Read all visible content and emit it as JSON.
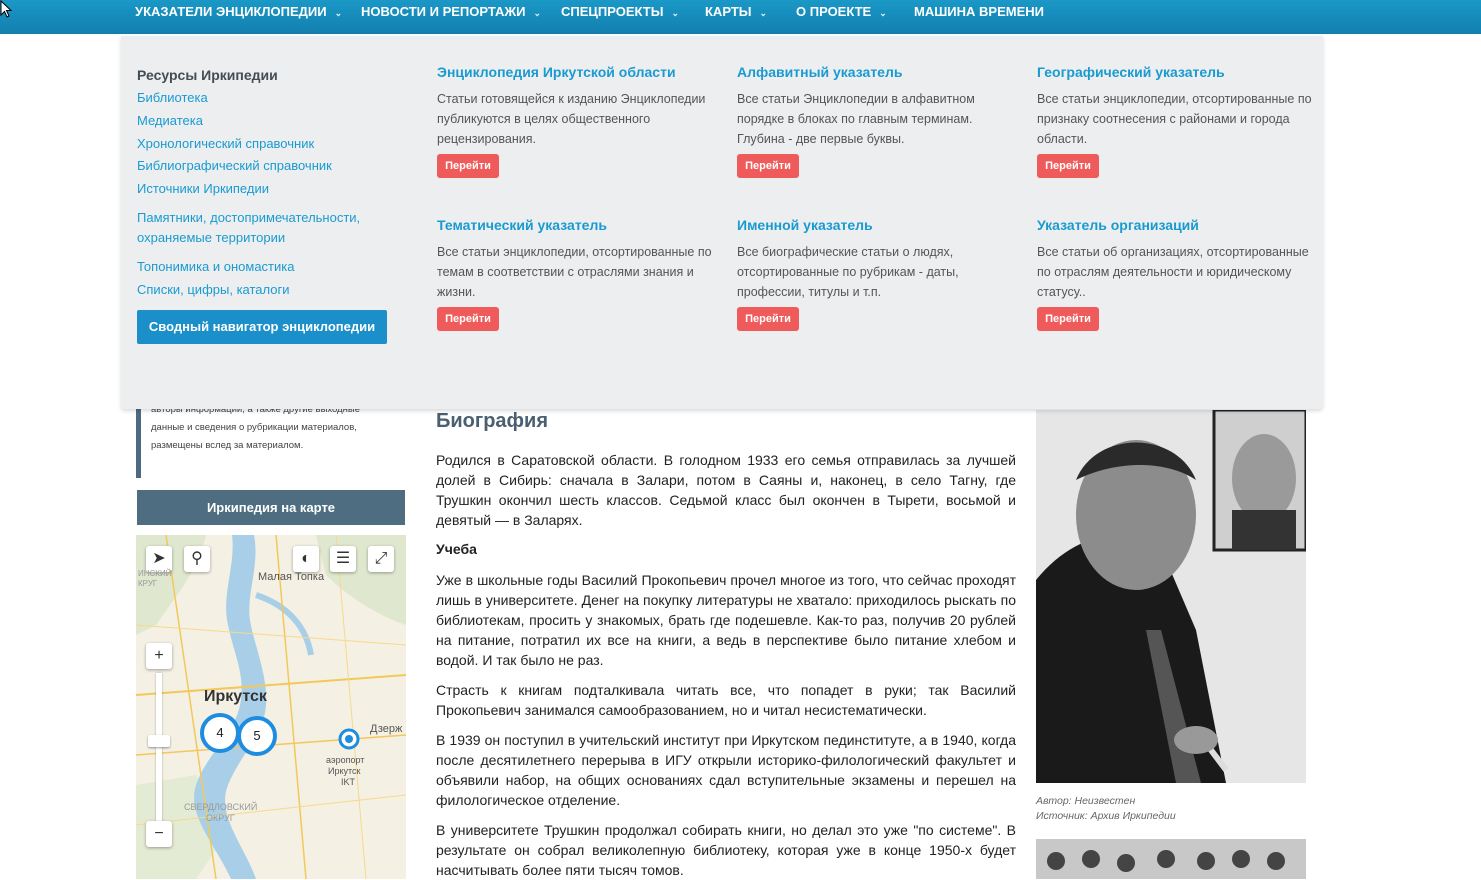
{
  "nav": {
    "items": [
      {
        "label": "УКАЗАТЕЛИ ЭНЦИКЛОПЕДИИ",
        "has_dropdown": true
      },
      {
        "label": "НОВОСТИ И РЕПОРТАЖИ",
        "has_dropdown": true
      },
      {
        "label": "СПЕЦПРОЕКТЫ",
        "has_dropdown": true
      },
      {
        "label": "КАРТЫ",
        "has_dropdown": true
      },
      {
        "label": "О ПРОЕКТЕ",
        "has_dropdown": true
      },
      {
        "label": "МАШИНА ВРЕМЕНИ",
        "has_dropdown": false
      }
    ]
  },
  "mega_menu": {
    "resources_title": "Ресурсы Иркипедии",
    "resources": [
      "Библиотека",
      "Медиатека",
      "Хронологический справочник",
      "Библиографический справочник",
      "Источники Иркипедии",
      "Памятники, достопримечательности, охраняемые территории",
      "Топонимика и ономастика",
      "Списки, цифры, каталоги"
    ],
    "summary_button": "Сводный навигатор энциклопедии",
    "cards": [
      {
        "title": "Энциклопедия Иркутской области",
        "desc": "Статьи готовящейся к изданию Энциклопедии публикуются в целях общественного рецензирования.",
        "button": "Перейти"
      },
      {
        "title": "Алфавитный указатель",
        "desc": "Все статьи Энциклопедии в алфавитном порядке в блоках по главным терминам. Глубина - две первые буквы.",
        "button": "Перейти"
      },
      {
        "title": "Географический указатель",
        "desc": "Все статьи энциклопедии, отсортированные по признаку соотнесения с районами и города области.",
        "button": "Перейти"
      },
      {
        "title": "Тематический указатель",
        "desc": "Все статьи энциклопедии, отсортированные по темам в соответствии с отраслями знания и жизни.",
        "button": "Перейти"
      },
      {
        "title": "Именной указатель",
        "desc": "Все биографические статьи о людях, отсортированные по рубрикам - даты, профессии, титулы и т.п.",
        "button": "Перейти"
      },
      {
        "title": "Указатель организаций",
        "desc": "Все статьи об организациях, отсортированные по отраслям деятельности и юридическому статусу..",
        "button": "Перейти"
      }
    ]
  },
  "sidebar": {
    "note_lines": [
      "авторы информации, а также другие выходные",
      "данные и сведения о рубрикации материалов,",
      "размещены вслед за материалом."
    ],
    "map_button": "Иркипедия на карте",
    "map": {
      "labels": {
        "malaya_topka": "Малая Топка",
        "irkutsk": "Иркутск",
        "dzerzh": "Дзерж",
        "airport": "аэропорт",
        "airport2": "Иркутск",
        "airport3": "IKT",
        "district": "СВЕРДЛОВСКИЙ",
        "district2": "ОКРУГ",
        "okrug_top": "ИНСКИЙ",
        "okrug_top2": "КРУГ"
      },
      "clusters": [
        "4",
        "5"
      ],
      "zoom_in": "+",
      "zoom_out": "−"
    }
  },
  "article": {
    "section_title": "Биография",
    "p1": "Родился в Саратовской области. В голодном 1933 его семья отправилась за лучшей долей в Сибирь: сначала в Залари, потом в Саяны и, наконец, в село Тагну, где Трушкин окончил шесть классов. Седьмой класс был окончен в Тырети, восьмой и девятый — в Заларях.",
    "subhead": "Учеба",
    "p2": "Уже в школьные годы Василий Прокопьевич прочел многое из того, что сейчас проходят лишь в университете. Денег на покупку литературы не хватало: приходилось рыскать по библиотекам, просить у знакомых, брать где подешевле. Как-то раз, получив 20 рублей на питание, потратил их все на книги, а ведь в перспективе было питание хлебом и водой. И так было не раз.",
    "p3": "Страсть к книгам подталкивала читать все, что попадет в руки; так Василий Прокопьевич занимался самообразованием, но и читал несистематически.",
    "p4": "В 1939 он поступил в учительский институт при Иркутском пединституте, а в 1940, когда после десятилетнего перерыва в ИГУ открыли историко-филологический факультет и объявили набор, на общих основаниях сдал вступительные экзамены и перешел на филологическое отделение.",
    "p5": "В университете Трушкин продолжал собирать книги, но делал это уже \"по системе\". В результате он собрал великолепную библиотеку, которая уже в конце 1950-х будет насчитывать более пяти тысяч томов."
  },
  "photo": {
    "author": "Автор: Неизвестен",
    "source": "Источник: Архив Иркипедии"
  },
  "colors": {
    "nav_bg": "#1a98c7",
    "link": "#1a9bd0",
    "button_red": "#ef5a5a",
    "summary_blue": "#1a8fc9",
    "map_bar": "#4e6d80"
  }
}
